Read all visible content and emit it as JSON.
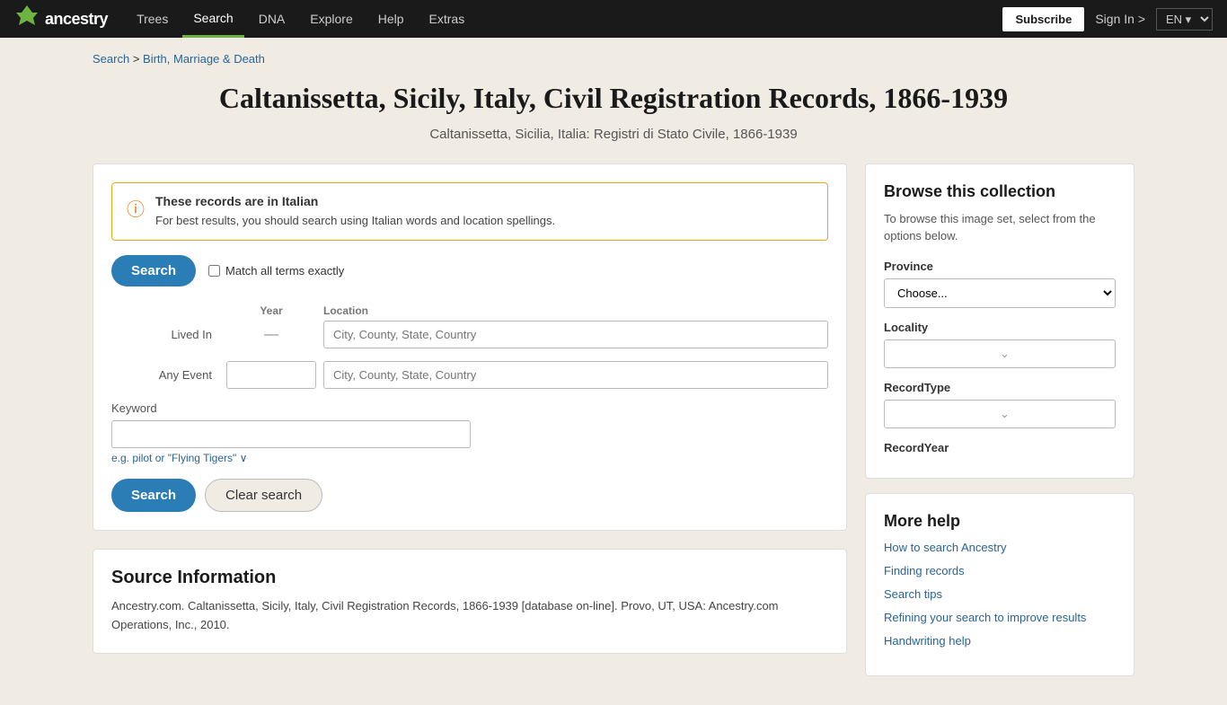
{
  "nav": {
    "logo_icon": "⚘",
    "logo_text": "ancestry",
    "links": [
      {
        "label": "Trees",
        "active": false
      },
      {
        "label": "Search",
        "active": true
      },
      {
        "label": "DNA",
        "active": false
      },
      {
        "label": "Explore",
        "active": false
      },
      {
        "label": "Help",
        "active": false
      },
      {
        "label": "Extras",
        "active": false
      }
    ],
    "subscribe_label": "Subscribe",
    "signin_label": "Sign In >",
    "lang_label": "EN ▾"
  },
  "breadcrumb": {
    "search_label": "Search",
    "separator": " > ",
    "current_label": "Birth, Marriage & Death"
  },
  "page": {
    "title": "Caltanissetta, Sicily, Italy, Civil Registration Records, 1866-1939",
    "subtitle": "Caltanissetta, Sicilia, Italia: Registri di Stato Civile, 1866-1939"
  },
  "alert": {
    "title": "These records are in Italian",
    "body": "For best results, you should search using Italian words and location spellings."
  },
  "search_form": {
    "search_button": "Search",
    "match_label": "Match all terms exactly",
    "year_header": "Year",
    "location_header": "Location",
    "lived_in_label": "Lived In",
    "lived_in_year_placeholder": "",
    "lived_in_year_dash": "—",
    "lived_in_location_placeholder": "City, County, State, Country",
    "any_event_label": "Any Event",
    "any_event_year_placeholder": "",
    "any_event_location_placeholder": "City, County, State, Country",
    "keyword_label": "Keyword",
    "keyword_placeholder": "",
    "keyword_example": "e.g. pilot or \"Flying Tigers\" ∨",
    "search_bottom_label": "Search",
    "clear_label": "Clear search"
  },
  "source": {
    "title": "Source Information",
    "text": "Ancestry.com. Caltanissetta, Sicily, Italy, Civil Registration Records, 1866-1939 [database on-line]. Provo, UT, USA: Ancestry.com Operations, Inc., 2010."
  },
  "browse": {
    "title": "Browse this collection",
    "description": "To browse this image set, select from the options below.",
    "province_label": "Province",
    "province_default": "Choose...",
    "locality_label": "Locality",
    "locality_placeholder": "",
    "record_type_label": "RecordType",
    "record_type_placeholder": "",
    "record_year_label": "RecordYear"
  },
  "help": {
    "title": "More help",
    "links": [
      "How to search Ancestry",
      "Finding records",
      "Search tips",
      "Refining your search to improve results",
      "Handwriting help"
    ]
  }
}
